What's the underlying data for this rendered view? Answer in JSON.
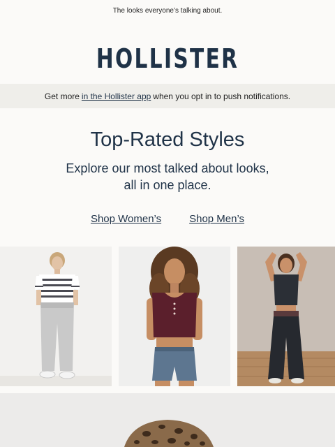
{
  "preheader": {
    "text": "The looks everyone’s talking about."
  },
  "logo": {
    "text": "HOLLISTER"
  },
  "app_banner": {
    "prefix": "Get more",
    "link": "in the Hollister app",
    "suffix": "when you opt in to push notifications."
  },
  "hero": {
    "title": "Top-Rated Styles",
    "subtitle_line1": "Explore our most talked about looks,",
    "subtitle_line2": "all in one place."
  },
  "shop_links": {
    "women": "Shop Women’s",
    "men": "Shop Men’s"
  },
  "photos": [
    {
      "icon": "male-model-striped-tee-grey-sweatpants"
    },
    {
      "icon": "female-model-burgundy-henley-denim-shorts"
    },
    {
      "icon": "female-model-black-tee-black-wide-pants"
    }
  ],
  "bottom": {
    "icon": "leopard-print-cap-image"
  },
  "colors": {
    "brand_navy": "#1f3247",
    "background": "#fbfaf8",
    "banner_bg": "#efeeea"
  }
}
